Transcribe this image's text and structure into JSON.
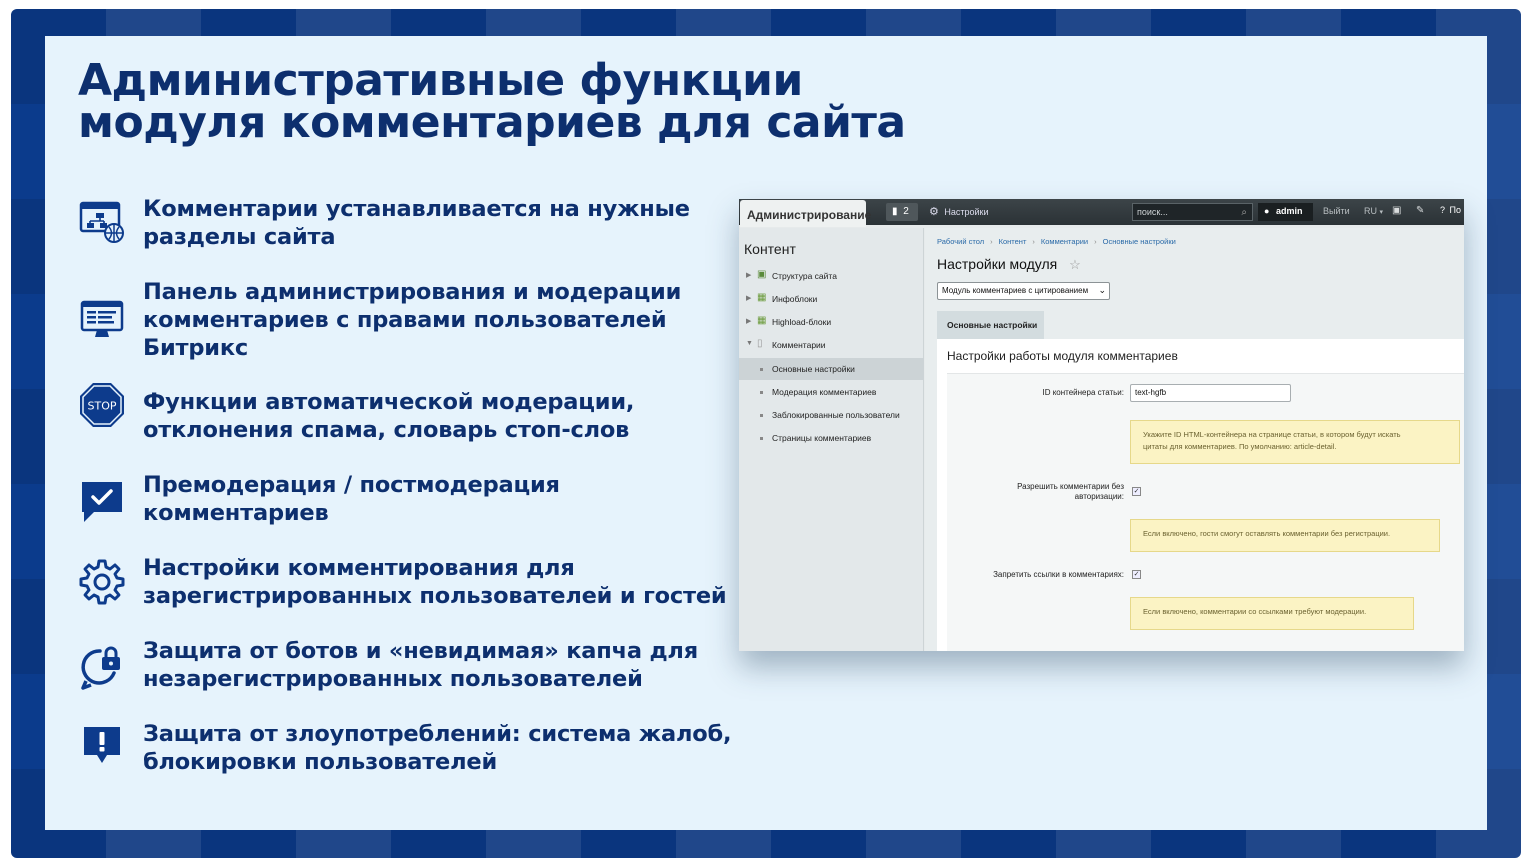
{
  "slide": {
    "title_line1": "Административные функции",
    "title_line2": "модуля комментариев для сайта",
    "colors": {
      "frame": "#0b3b8c",
      "panel": "#e6f3fc",
      "text": "#0d2f6e"
    }
  },
  "features": [
    {
      "icon": "sitemap-globe-icon",
      "line1": "Комментарии устанавливается на нужные",
      "line2": "разделы сайта",
      "line3": ""
    },
    {
      "icon": "admin-monitor-icon",
      "line1": "Панель администрирования и модерации",
      "line2": "комментариев с правами пользователей",
      "line3": "Битрикс"
    },
    {
      "icon": "stop-sign-icon",
      "icon_text": "STOP",
      "line1": "Функции автоматической модерации,",
      "line2": "отклонения спама, словарь стоп-слов",
      "line3": ""
    },
    {
      "icon": "chat-check-icon",
      "line1": "Премодерация / постмодерация",
      "line2": "комментариев",
      "line3": ""
    },
    {
      "icon": "gear-icon",
      "line1": "Настройки комментирования для",
      "line2": "зарегистрированных пользователей и гостей",
      "line3": ""
    },
    {
      "icon": "chat-lock-icon",
      "line1": "Защита от ботов и «невидимая» капча для",
      "line2": "незарегистрированных пользователей",
      "line3": ""
    },
    {
      "icon": "chat-alert-icon",
      "line1": "Защита от злоупотреблений: система жалоб,",
      "line2": "блокировки пользователей",
      "line3": ""
    }
  ],
  "admin": {
    "topbar": {
      "tab": "Администрирование",
      "badge": "2",
      "settings": "Настройки",
      "search_placeholder": "поиск...",
      "user": "admin",
      "exit": "Выйти",
      "lang": "RU",
      "help": "По"
    },
    "sidebar": {
      "title": "Контент",
      "items": [
        {
          "label": "Структура сайта",
          "icon": "sitemap-icon"
        },
        {
          "label": "Инфоблоки",
          "icon": "infoblock-icon"
        },
        {
          "label": "Highload-блоки",
          "icon": "highload-icon"
        },
        {
          "label": "Комментарии",
          "icon": "page-icon"
        }
      ],
      "subitems": [
        "Основные настройки",
        "Модерация комментариев",
        "Заблокированные пользователи",
        "Страницы комментариев"
      ]
    },
    "breadcrumbs": [
      "Рабочий стол",
      "Контент",
      "Комментарии",
      "Основные настройки"
    ],
    "page_title": "Настройки модуля",
    "module_select": "Модуль комментариев с цитированием",
    "tab": "Основные настройки",
    "form_title": "Настройки работы модуля комментариев",
    "fields": {
      "container_label": "ID контейнера статьи:",
      "container_value": "text-hgfb",
      "container_note_1": "Укажите ID HTML-контейнера на странице статьи, в котором будут искать",
      "container_note_2": "цитаты для комментариев. По умолчанию: article-detail.",
      "anon_label_1": "Разрешить комментарии без",
      "anon_label_2": "авторизации:",
      "anon_checked": true,
      "anon_note": "Если включено, гости смогут оставлять комментарии без регистрации.",
      "links_label": "Запретить ссылки в комментариях:",
      "links_checked": true,
      "links_note": "Если включено, комментарии со ссылками требуют модерации."
    }
  }
}
